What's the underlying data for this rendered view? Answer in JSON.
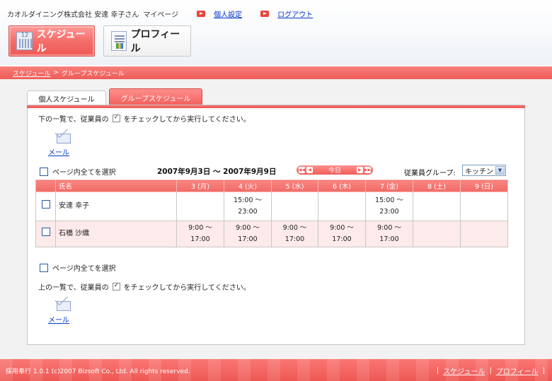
{
  "header": {
    "user_text": "カオルダイニング株式会社 安達 幸子さん",
    "mypage": "マイページ",
    "settings_link": "個人設定",
    "logout_link": "ログアウト"
  },
  "nav": {
    "schedule_button": "スケジュール",
    "profile_button": "プロフィール"
  },
  "breadcrumb": {
    "parent": "スケジュール",
    "separator": ">",
    "current": "グループスケジュール"
  },
  "tabs": {
    "personal": "個人スケジュール",
    "group": "グループスケジュール"
  },
  "instructions": {
    "before": "下の一覧で、従業員の",
    "after": "をチェックしてから実行してください。",
    "bottom_before": "上の一覧で、従業員の",
    "bottom_after": "をチェックしてから実行してください。"
  },
  "mail": {
    "label": "メール"
  },
  "select_all": "ページ内全てを選択",
  "date_range": "2007年9月3日 〜 2007年9月9日",
  "date_nav": {
    "today": "今日"
  },
  "employee_group": {
    "label": "従業員グループ:",
    "selected": "キッチン"
  },
  "table": {
    "headers": [
      "氏名",
      "3 (月)",
      "4 (火)",
      "5 (水)",
      "6 (木)",
      "7 (金)",
      "8 (土)",
      "9 (日)"
    ],
    "rows": [
      {
        "name": "安達 幸子",
        "cells": [
          {
            "start": "",
            "end": ""
          },
          {
            "start": "15:00 〜",
            "end": "23:00"
          },
          {
            "start": "",
            "end": ""
          },
          {
            "start": "",
            "end": ""
          },
          {
            "start": "15:00 〜",
            "end": "23:00"
          },
          {
            "start": "",
            "end": ""
          },
          {
            "start": "",
            "end": ""
          }
        ]
      },
      {
        "name": "石橋 沙織",
        "cells": [
          {
            "start": "9:00 〜",
            "end": "17:00"
          },
          {
            "start": "9:00 〜",
            "end": "17:00"
          },
          {
            "start": "9:00 〜",
            "end": "17:00"
          },
          {
            "start": "9:00 〜",
            "end": "17:00"
          },
          {
            "start": "9:00 〜",
            "end": "17:00"
          },
          {
            "start": "",
            "end": ""
          },
          {
            "start": "",
            "end": ""
          }
        ]
      }
    ]
  },
  "footer": {
    "copyright": "採用奉行 1.0.1 (c)2007 Bizsoft Co., Ltd. All rights reserved.",
    "link_schedule": "スケジュール",
    "link_profile": "プロフィール",
    "separator": "|"
  },
  "colors": {
    "accent": "#ef5b57",
    "row_highlight": "#fdeaea",
    "link": "#0033cc"
  }
}
